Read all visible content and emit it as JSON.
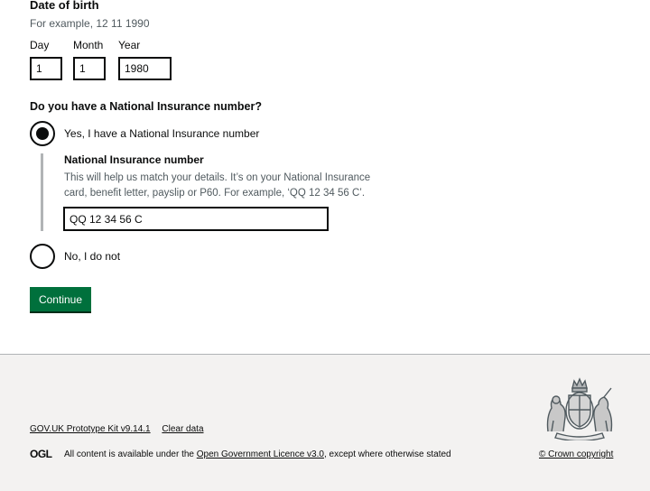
{
  "dob": {
    "heading": "Date of birth",
    "hint": "For example, 12 11 1990",
    "day": {
      "label": "Day",
      "value": "1"
    },
    "month": {
      "label": "Month",
      "value": "1"
    },
    "year": {
      "label": "Year",
      "value": "1980"
    }
  },
  "ni": {
    "legend": "Do you have a National Insurance number?",
    "yes_label": "Yes, I have a National Insurance number",
    "no_label": "No, I do not",
    "selected": "yes",
    "field_label": "National Insurance number",
    "hint_line1": "This will help us match your details. It’s on your National Insurance",
    "hint_line2": "card, benefit letter, payslip or P60. For example, ‘QQ 12 34 56 C’.",
    "value": "QQ 12 34 56 C"
  },
  "continue_label": "Continue",
  "footer": {
    "links": [
      "GOV.UK Prototype Kit v9.14.1",
      "Clear data"
    ],
    "ogl": "OGL",
    "licence_prefix": "All content is available under the ",
    "licence_link": "Open Government Licence v3.0",
    "licence_suffix": ", except where otherwise stated",
    "copyright": "© Crown copyright",
    "crest_icon": "royal-coat-of-arms-icon"
  },
  "colors": {
    "button_green": "#00703c",
    "footer_bg": "#f3f2f1",
    "hint_grey": "#505a5f",
    "text": "#0b0c0c"
  }
}
